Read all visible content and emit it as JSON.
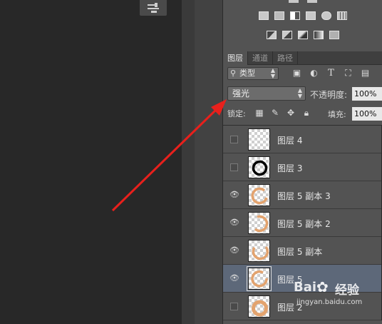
{
  "toolbar": {
    "tool_icon": "brush-adjust-icon"
  },
  "adjustments": {
    "row1_icons": [
      "brightness-icon",
      "levels-icon",
      "curves-icon",
      "exposure-icon"
    ],
    "row2_icons": [
      "vibrance-icon",
      "balance-icon",
      "bw-icon",
      "photo-filter-icon",
      "channel-mixer-icon",
      "color-lookup-icon"
    ],
    "row3_icons": [
      "invert-icon",
      "posterize-icon",
      "threshold-icon",
      "gradient-map-icon",
      "selective-color-icon"
    ]
  },
  "tabs": [
    {
      "label": "图层",
      "active": true
    },
    {
      "label": "通道",
      "active": false
    },
    {
      "label": "路径",
      "active": false
    }
  ],
  "filter": {
    "label": "类型",
    "icons": [
      "image-icon",
      "adjustment-icon",
      "text-icon",
      "shape-icon",
      "smart-object-icon"
    ]
  },
  "blend_mode": {
    "value": "强光"
  },
  "opacity": {
    "label": "不透明度:",
    "value": "100%"
  },
  "lock": {
    "label": "锁定:",
    "icons": [
      "lock-transparent-icon",
      "lock-paint-icon",
      "lock-move-icon",
      "lock-all-icon"
    ]
  },
  "fill": {
    "label": "填充:",
    "value": "100%"
  },
  "layers": [
    {
      "name": "图层 4",
      "visible": false,
      "selected": false,
      "thumb": "empty"
    },
    {
      "name": "图层 3",
      "visible": false,
      "selected": false,
      "thumb": "black-ring"
    },
    {
      "name": "图层 5 副本 3",
      "visible": true,
      "selected": false,
      "thumb": "orange-ring"
    },
    {
      "name": "图层 5 副本 2",
      "visible": true,
      "selected": false,
      "thumb": "orange-ring-part"
    },
    {
      "name": "图层 5 副本",
      "visible": true,
      "selected": false,
      "thumb": "orange-ring"
    },
    {
      "name": "图层 5",
      "visible": true,
      "selected": true,
      "thumb": "orange-ring"
    },
    {
      "name": "图层 2",
      "visible": false,
      "selected": false,
      "thumb": "orange-ring-thick"
    }
  ],
  "watermark": {
    "brand": "Bai",
    "brand_cn": "经验",
    "url": "jingyan.baidu.com"
  },
  "colors": {
    "arrow": "#e8201c",
    "selected_row": "#5d6879",
    "panel": "#535353"
  }
}
